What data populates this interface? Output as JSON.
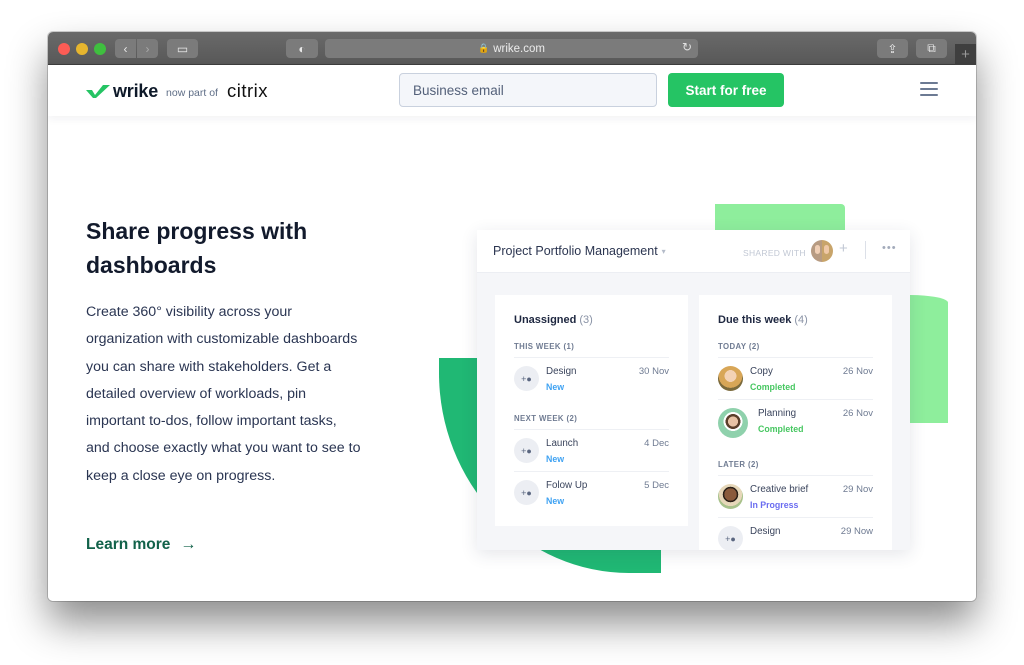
{
  "browser": {
    "url": "wrike.com",
    "controls": {
      "back": "‹",
      "forward": "›",
      "sidebar": "▭",
      "shield": "◐",
      "reload": "↻",
      "share": "⇪",
      "tabs": "⧉",
      "new_tab": "+"
    }
  },
  "nav": {
    "logo_text": "wrike",
    "now_part_of": "now part of",
    "partner": "citrix",
    "email_placeholder": "Business email",
    "cta_label": "Start for free",
    "menu_icon": "hamburger-icon"
  },
  "hero": {
    "title": "Share progress with dashboards",
    "body": "Create 360° visibility across your organization with customizable dashboards you can share with stakeholders. Get a detailed overview of workloads, pin important to-dos, follow important tasks, and choose exactly what you want to see to keep a close eye on progress.",
    "link_label": "Learn more",
    "link_arrow": "→"
  },
  "dashboard": {
    "title": "Project Portfolio Management",
    "caret": "▾",
    "shared_with": "SHARED WITH",
    "add": "+",
    "more": "•••",
    "columns": [
      {
        "title": "Unassigned",
        "count": "(3)",
        "groups": [
          {
            "label": "THIS WEEK (1)",
            "tasks": [
              {
                "name": "Design",
                "status": "New",
                "date": "30 Nov",
                "avatar": "add-user"
              }
            ]
          },
          {
            "label": "NEXT WEEK (2)",
            "tasks": [
              {
                "name": "Launch",
                "status": "New",
                "date": "4 Dec",
                "avatar": "add-user"
              },
              {
                "name": "Folow Up",
                "status": "New",
                "date": "5 Dec",
                "avatar": "add-user"
              }
            ]
          }
        ]
      },
      {
        "title": "Due this week",
        "count": "(4)",
        "groups": [
          {
            "label": "TODAY (2)",
            "tasks": [
              {
                "name": "Copy",
                "status": "Completed",
                "date": "26 Nov",
                "avatar": "photo"
              },
              {
                "name": "Planning",
                "status": "Completed",
                "date": "26 Nov",
                "avatar": "photo"
              }
            ]
          },
          {
            "label": "LATER (2)",
            "tasks": [
              {
                "name": "Creative brief",
                "status": "In Progress",
                "date": "29 Nov",
                "avatar": "photo"
              },
              {
                "name": "Design",
                "status": "",
                "date": "29 Now",
                "avatar": "add-user"
              }
            ]
          }
        ]
      }
    ],
    "add_user_glyph": "+👤"
  },
  "colors": {
    "brand_green": "#25c464",
    "accent_green_light": "#8eee9c",
    "accent_green_dark": "#20b874",
    "link_green": "#12624a",
    "status_new": "#3fa2f2",
    "status_completed": "#47c761",
    "status_in_progress": "#6a6cf0"
  }
}
